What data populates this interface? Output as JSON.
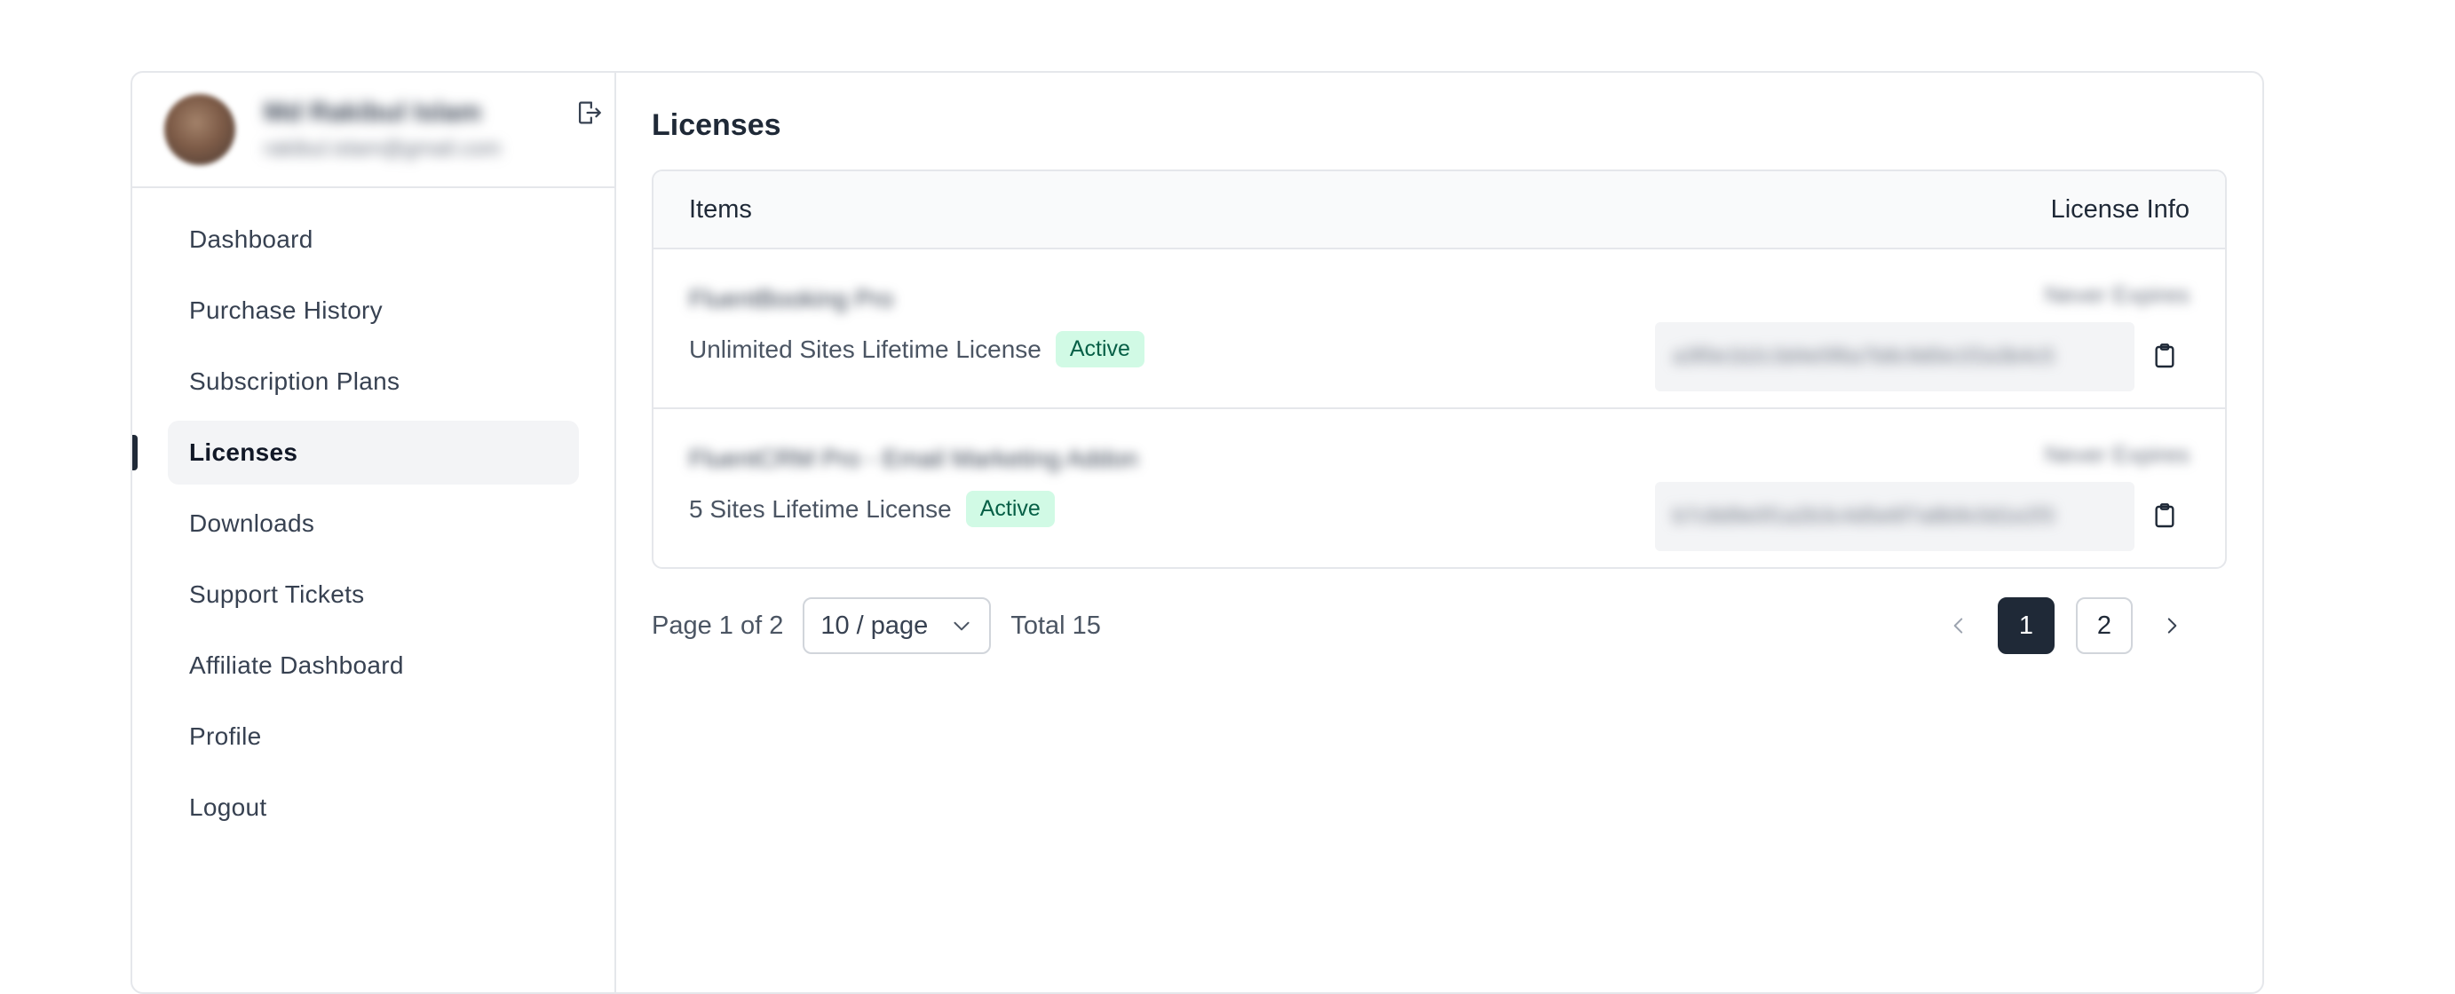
{
  "user": {
    "name": "Md Rakibul Islam",
    "email": "rakibul.islam@gmail.com"
  },
  "sidebar": {
    "items": [
      {
        "label": "Dashboard"
      },
      {
        "label": "Purchase History"
      },
      {
        "label": "Subscription Plans"
      },
      {
        "label": "Licenses"
      },
      {
        "label": "Downloads"
      },
      {
        "label": "Support Tickets"
      },
      {
        "label": "Affiliate Dashboard"
      },
      {
        "label": "Profile"
      },
      {
        "label": "Logout"
      }
    ],
    "active": "Licenses"
  },
  "main": {
    "title": "Licenses",
    "table": {
      "headers": {
        "items": "Items",
        "info": "License Info"
      },
      "rows": [
        {
          "product": "FluentBooking Pro",
          "license": "Unlimited Sites Lifetime License",
          "status": "Active",
          "info_label": "Never Expires",
          "key": "a3f0e1b2c3d4e5f6a7b8c9d0e1f2a3b4c5"
        },
        {
          "product": "FluentCRM Pro - Email Marketing Addon",
          "license": "5 Sites Lifetime License",
          "status": "Active",
          "info_label": "Never Expires",
          "key": "b7c8d9e0f1a2b3c4d5e6f7a8b9c0d1e2f3"
        }
      ]
    },
    "pagination": {
      "page_of": "Page 1 of 2",
      "per_page": "10 / page",
      "total": "Total 15",
      "pages": [
        "1",
        "2"
      ],
      "current": "1"
    }
  },
  "colors": {
    "accent": "#1f2937",
    "badge_bg": "#d1fae5",
    "badge_text": "#065f46",
    "border": "#e5e7eb"
  },
  "icons": {
    "logout": "logout-icon",
    "copy": "clipboard-icon",
    "dropdown": "chevron-down-icon",
    "prev": "chevron-left-icon",
    "next": "chevron-right-icon"
  }
}
